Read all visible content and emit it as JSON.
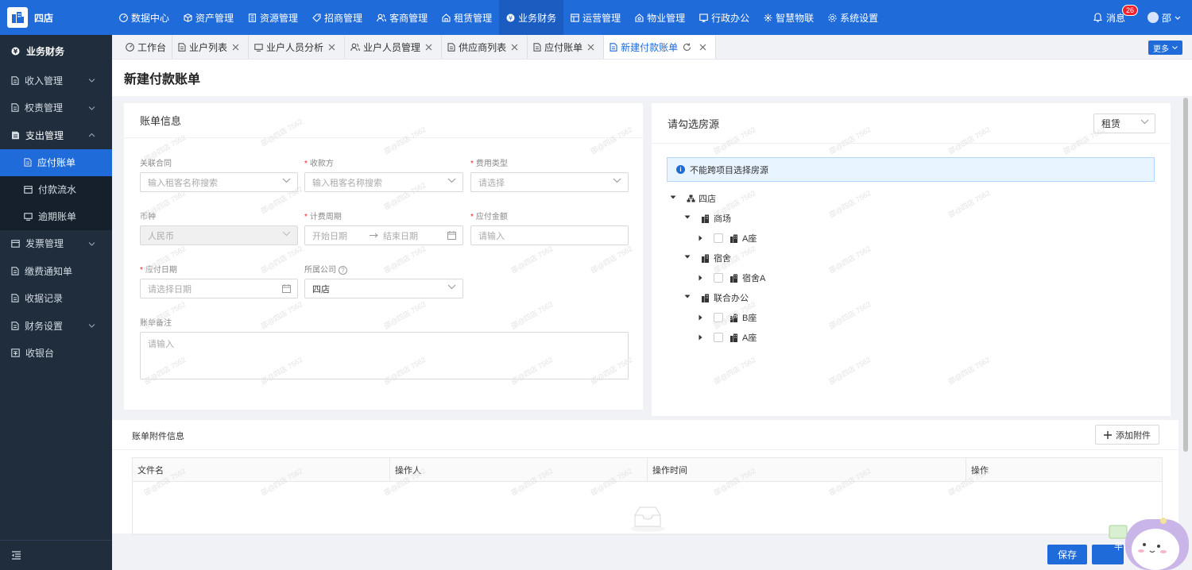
{
  "app": {
    "store_name": "四店"
  },
  "top_nav": [
    {
      "label": "数据中心",
      "icon": "dashboard-icon"
    },
    {
      "label": "资产管理",
      "icon": "cube-icon"
    },
    {
      "label": "资源管理",
      "icon": "building-icon"
    },
    {
      "label": "招商管理",
      "icon": "tag-icon"
    },
    {
      "label": "客商管理",
      "icon": "users-icon"
    },
    {
      "label": "租赁管理",
      "icon": "house-icon"
    },
    {
      "label": "业务财务",
      "icon": "finance-icon",
      "active": true
    },
    {
      "label": "运营管理",
      "icon": "ops-icon"
    },
    {
      "label": "物业管理",
      "icon": "property-icon"
    },
    {
      "label": "行政办公",
      "icon": "office-icon"
    },
    {
      "label": "智慧物联",
      "icon": "iot-icon"
    },
    {
      "label": "系统设置",
      "icon": "settings-icon"
    }
  ],
  "header_right": {
    "messages_label": "消息",
    "message_count": "26",
    "user_name": "邵"
  },
  "sidebar": {
    "section": "业务财务",
    "items": [
      {
        "label": "收入管理",
        "chevron": "down"
      },
      {
        "label": "权责管理",
        "chevron": "down"
      },
      {
        "label": "支出管理",
        "chevron": "up"
      },
      {
        "label": "应付账单",
        "sub": true,
        "active": true
      },
      {
        "label": "付款流水",
        "sub": true
      },
      {
        "label": "逾期账单",
        "sub": true
      },
      {
        "label": "发票管理",
        "chevron": "down"
      },
      {
        "label": "缴费通知单"
      },
      {
        "label": "收据记录"
      },
      {
        "label": "财务设置",
        "chevron": "down"
      },
      {
        "label": "收银台"
      }
    ]
  },
  "tabs": [
    {
      "label": "工作台",
      "closable": false
    },
    {
      "label": "业户列表",
      "closable": true
    },
    {
      "label": "业户人员分析",
      "closable": true
    },
    {
      "label": "业户人员管理",
      "closable": true
    },
    {
      "label": "供应商列表",
      "closable": true
    },
    {
      "label": "应付账单",
      "closable": true
    },
    {
      "label": "新建付款账单",
      "closable": true,
      "active": true
    }
  ],
  "tabs_more": "更多",
  "page_title": "新建付款账单",
  "bill_info": {
    "title": "账单信息",
    "contract_label": "关联合同",
    "contract_placeholder": "输入租客名称搜索",
    "payee_label": "收款方",
    "payee_placeholder": "输入租客名称搜索",
    "fee_type_label": "费用类型",
    "fee_type_placeholder": "请选择",
    "currency_label": "币种",
    "currency_value": "人民币",
    "period_label": "计费周期",
    "period_start": "开始日期",
    "period_end": "结束日期",
    "amount_label": "应付金额",
    "amount_placeholder": "请输入",
    "due_label": "应付日期",
    "due_placeholder": "请选择日期",
    "company_label": "所属公司",
    "company_value": "四店",
    "remark_label": "账单备注",
    "remark_placeholder": "请输入"
  },
  "room_select": {
    "title": "请勾选房源",
    "mode_value": "租赁",
    "notice": "不能跨项目选择房源",
    "tree": {
      "root": "四店",
      "groups": [
        {
          "name": "商场",
          "children": [
            "A座"
          ]
        },
        {
          "name": "宿舍",
          "children": [
            "宿舍A"
          ]
        },
        {
          "name": "联合办公",
          "children": [
            "B座",
            "A座"
          ]
        }
      ]
    }
  },
  "attachments": {
    "title": "账单附件信息",
    "add_button": "添加附件",
    "columns": [
      "文件名",
      "操作人",
      "操作时间",
      "操作"
    ]
  },
  "footer": {
    "save_label": "保存"
  },
  "watermark": "邵@四店 7562",
  "mascot_text": "半 中"
}
